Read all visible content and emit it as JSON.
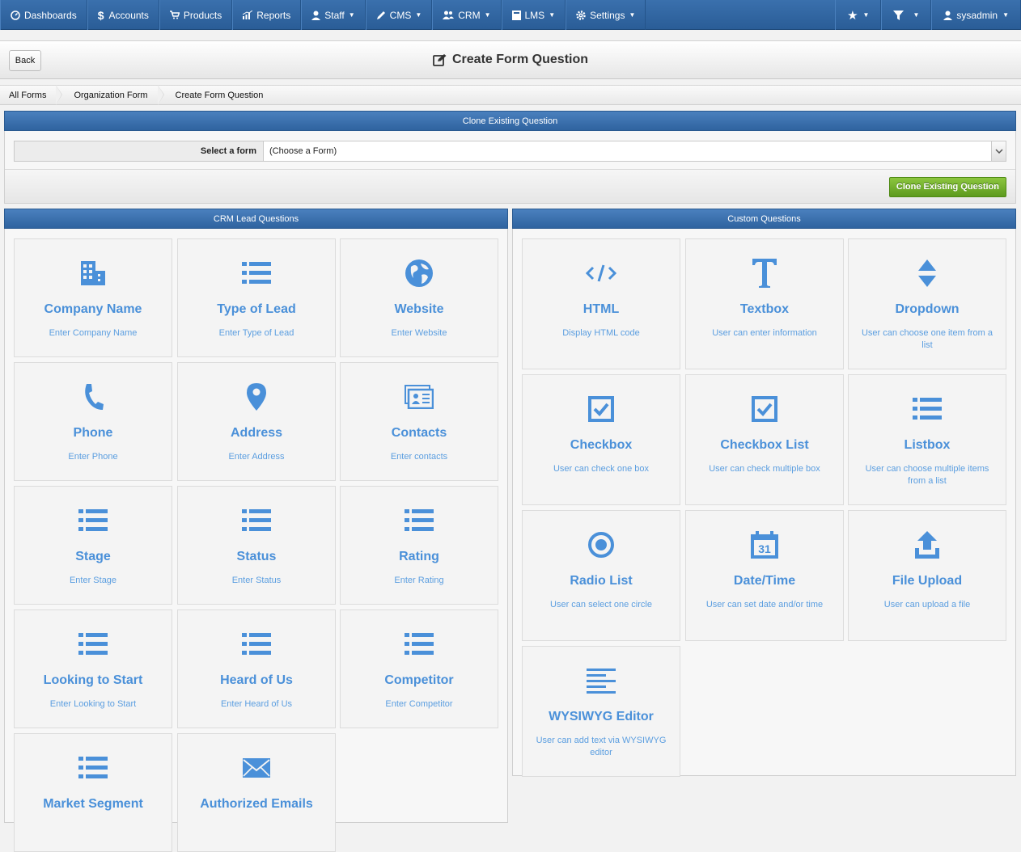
{
  "nav": {
    "items": [
      {
        "label": "Dashboards",
        "icon": "dashboard-icon",
        "caret": false
      },
      {
        "label": "Accounts",
        "icon": "dollar-icon",
        "caret": false
      },
      {
        "label": "Products",
        "icon": "cart-icon",
        "caret": false
      },
      {
        "label": "Reports",
        "icon": "chart-icon",
        "caret": false
      },
      {
        "label": "Staff",
        "icon": "user-icon",
        "caret": true
      },
      {
        "label": "CMS",
        "icon": "pencil-icon",
        "caret": true
      },
      {
        "label": "CRM",
        "icon": "users-icon",
        "caret": true
      },
      {
        "label": "LMS",
        "icon": "book-icon",
        "caret": true
      },
      {
        "label": "Settings",
        "icon": "gear-icon",
        "caret": true
      }
    ],
    "user": "sysadmin"
  },
  "header": {
    "back_label": "Back",
    "title": "Create Form Question"
  },
  "breadcrumb": [
    "All Forms",
    "Organization Form",
    "Create Form Question"
  ],
  "clone": {
    "heading": "Clone Existing Question",
    "select_label": "Select a form",
    "select_value": "(Choose a Form)",
    "button_label": "Clone Existing Question"
  },
  "crm_panel": {
    "heading": "CRM Lead Questions",
    "cards": [
      {
        "title": "Company Name",
        "desc": "Enter Company Name",
        "icon": "building-icon"
      },
      {
        "title": "Type of Lead",
        "desc": "Enter Type of Lead",
        "icon": "list-icon"
      },
      {
        "title": "Website",
        "desc": "Enter Website",
        "icon": "globe-icon"
      },
      {
        "title": "Phone",
        "desc": "Enter Phone",
        "icon": "phone-icon"
      },
      {
        "title": "Address",
        "desc": "Enter Address",
        "icon": "map-pin-icon"
      },
      {
        "title": "Contacts",
        "desc": "Enter contacts",
        "icon": "contact-card-icon"
      },
      {
        "title": "Stage",
        "desc": "Enter Stage",
        "icon": "list-icon"
      },
      {
        "title": "Status",
        "desc": "Enter Status",
        "icon": "list-icon"
      },
      {
        "title": "Rating",
        "desc": "Enter Rating",
        "icon": "list-icon"
      },
      {
        "title": "Looking to Start",
        "desc": "Enter Looking to Start",
        "icon": "list-icon"
      },
      {
        "title": "Heard of Us",
        "desc": "Enter Heard of Us",
        "icon": "list-icon"
      },
      {
        "title": "Competitor",
        "desc": "Enter Competitor",
        "icon": "list-icon"
      },
      {
        "title": "Market Segment",
        "desc": "",
        "icon": "list-icon"
      },
      {
        "title": "Authorized Emails",
        "desc": "",
        "icon": "envelope-icon"
      }
    ]
  },
  "custom_panel": {
    "heading": "Custom Questions",
    "cards": [
      {
        "title": "HTML",
        "desc": "Display HTML code",
        "icon": "code-icon"
      },
      {
        "title": "Textbox",
        "desc": "User can enter information",
        "icon": "text-icon"
      },
      {
        "title": "Dropdown",
        "desc": "User can choose one item from a list",
        "icon": "sort-icon"
      },
      {
        "title": "Checkbox",
        "desc": "User can check one box",
        "icon": "checkbox-icon"
      },
      {
        "title": "Checkbox List",
        "desc": "User can check multiple box",
        "icon": "checkbox-icon"
      },
      {
        "title": "Listbox",
        "desc": "User can choose multiple items from a list",
        "icon": "list-icon"
      },
      {
        "title": "Radio List",
        "desc": "User can select one circle",
        "icon": "radio-icon"
      },
      {
        "title": "Date/Time",
        "desc": "User can set date and/or time",
        "icon": "calendar-icon"
      },
      {
        "title": "File Upload",
        "desc": "User can upload a file",
        "icon": "upload-icon"
      },
      {
        "title": "WYSIWYG Editor",
        "desc": "User can add text via WYSIWYG editor",
        "icon": "align-left-icon"
      }
    ]
  },
  "colors": {
    "accent": "#4a90d9",
    "nav": "#2f639f",
    "button_green": "#6aaa2a"
  }
}
